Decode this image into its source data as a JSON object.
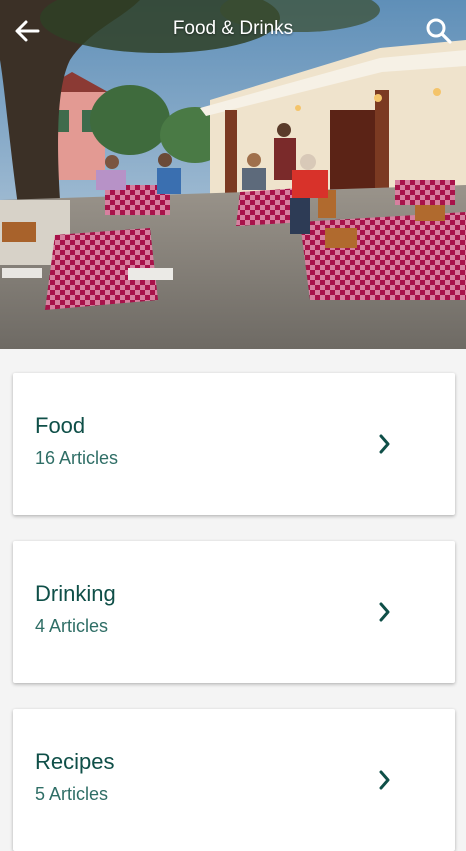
{
  "appbar": {
    "title": "Food & Drinks",
    "back_icon": "arrow-back-icon",
    "search_icon": "search-icon"
  },
  "hero": {
    "image": "restaurant-terrace-photo"
  },
  "categories": [
    {
      "name": "Food",
      "count": "16 Articles"
    },
    {
      "name": "Drinking",
      "count": "4 Articles"
    },
    {
      "name": "Recipes",
      "count": "5 Articles"
    }
  ],
  "colors": {
    "accent": "#0f4f48",
    "card_background": "#ffffff",
    "page_background": "#f4f4f4",
    "appbar_text": "#ffffff"
  }
}
